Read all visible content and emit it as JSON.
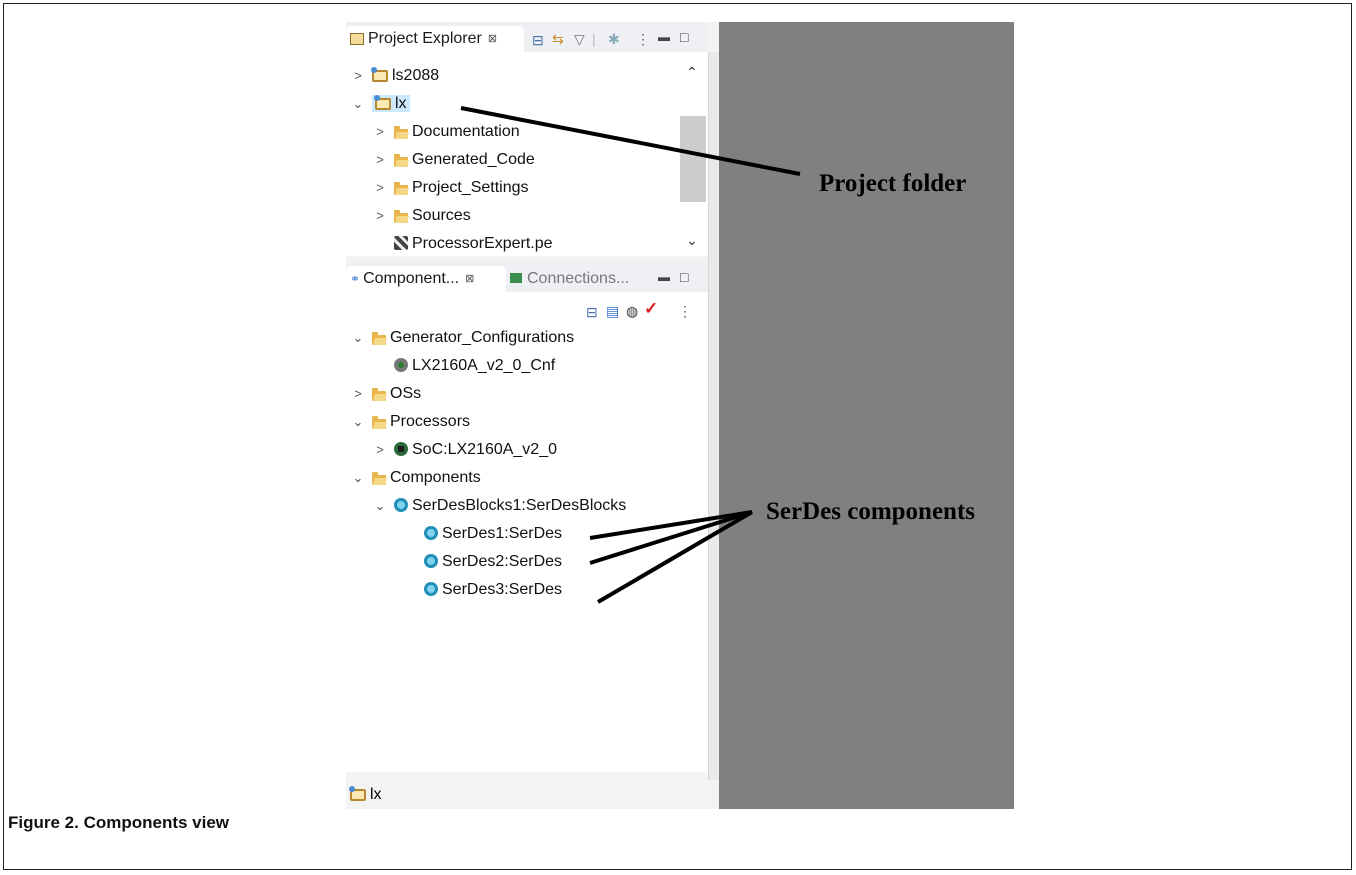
{
  "project_explorer": {
    "tab_label": "Project Explorer",
    "tab_close": "⊠",
    "items": [
      {
        "label": "ls2088",
        "expanded": false,
        "icon": "project-icon"
      },
      {
        "label": "lx",
        "expanded": true,
        "icon": "project-icon",
        "selected": true
      },
      {
        "label": "Documentation",
        "expanded": false,
        "icon": "folder-icon"
      },
      {
        "label": "Generated_Code",
        "expanded": false,
        "icon": "folder-icon"
      },
      {
        "label": "Project_Settings",
        "expanded": false,
        "icon": "folder-icon"
      },
      {
        "label": "Sources",
        "expanded": false,
        "icon": "folder-icon"
      },
      {
        "label": "ProcessorExpert.pe",
        "icon": "pe-file-icon"
      }
    ]
  },
  "components_view": {
    "tab_label": "Component...",
    "tab_close": "⊠",
    "connections_tab_label": "Connections...",
    "items": [
      {
        "label": "Generator_Configurations",
        "expanded": true,
        "icon": "folder-icon"
      },
      {
        "label": "LX2160A_v2_0_Cnf",
        "icon": "config-gear-icon"
      },
      {
        "label": "OSs",
        "expanded": false,
        "icon": "folder-icon"
      },
      {
        "label": "Processors",
        "expanded": true,
        "icon": "folder-icon"
      },
      {
        "label": "SoC:LX2160A_v2_0",
        "expanded": false,
        "icon": "processor-chip-icon"
      },
      {
        "label": "Components",
        "expanded": true,
        "icon": "folder-icon"
      },
      {
        "label": "SerDesBlocks1:SerDesBlocks",
        "expanded": true,
        "icon": "component-icon"
      },
      {
        "label": "SerDes1:SerDes",
        "icon": "component-icon"
      },
      {
        "label": "SerDes2:SerDes",
        "icon": "component-icon"
      },
      {
        "label": "SerDes3:SerDes",
        "icon": "component-icon"
      }
    ]
  },
  "status_bar": {
    "label": "lx"
  },
  "annotations": {
    "project_folder": "Project folder",
    "serdes_components": "SerDes components"
  },
  "caption": "Figure 2. Components view"
}
